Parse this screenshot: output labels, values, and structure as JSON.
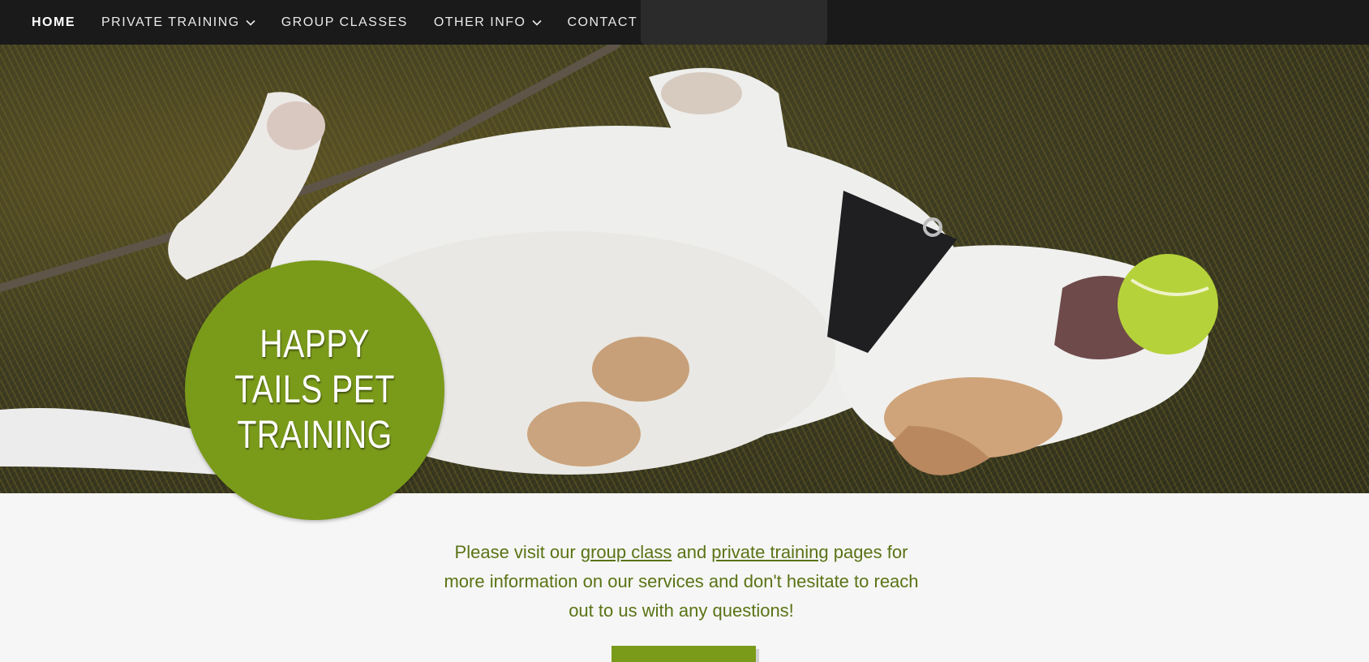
{
  "nav": {
    "items": [
      {
        "label": "HOME",
        "active": true,
        "dropdown": false
      },
      {
        "label": "PRIVATE TRAINING",
        "active": false,
        "dropdown": true
      },
      {
        "label": "GROUP CLASSES",
        "active": false,
        "dropdown": false
      },
      {
        "label": "OTHER INFO",
        "active": false,
        "dropdown": true
      },
      {
        "label": "CONTACT",
        "active": false,
        "dropdown": false
      }
    ]
  },
  "hero": {
    "badge_title": "HAPPY TAILS PET TRAINING"
  },
  "intro": {
    "text_1": "Please visit our ",
    "link_group": "group class",
    "text_2": " and ",
    "link_private": "private training",
    "text_3": " pages for more information on our services and don't hesitate to reach out to us with any questions!"
  },
  "colors": {
    "accent": "#7a9a1a",
    "text_green": "#5a7315",
    "nav_bg": "#1a1a1a",
    "page_bg": "#f6f6f6"
  }
}
